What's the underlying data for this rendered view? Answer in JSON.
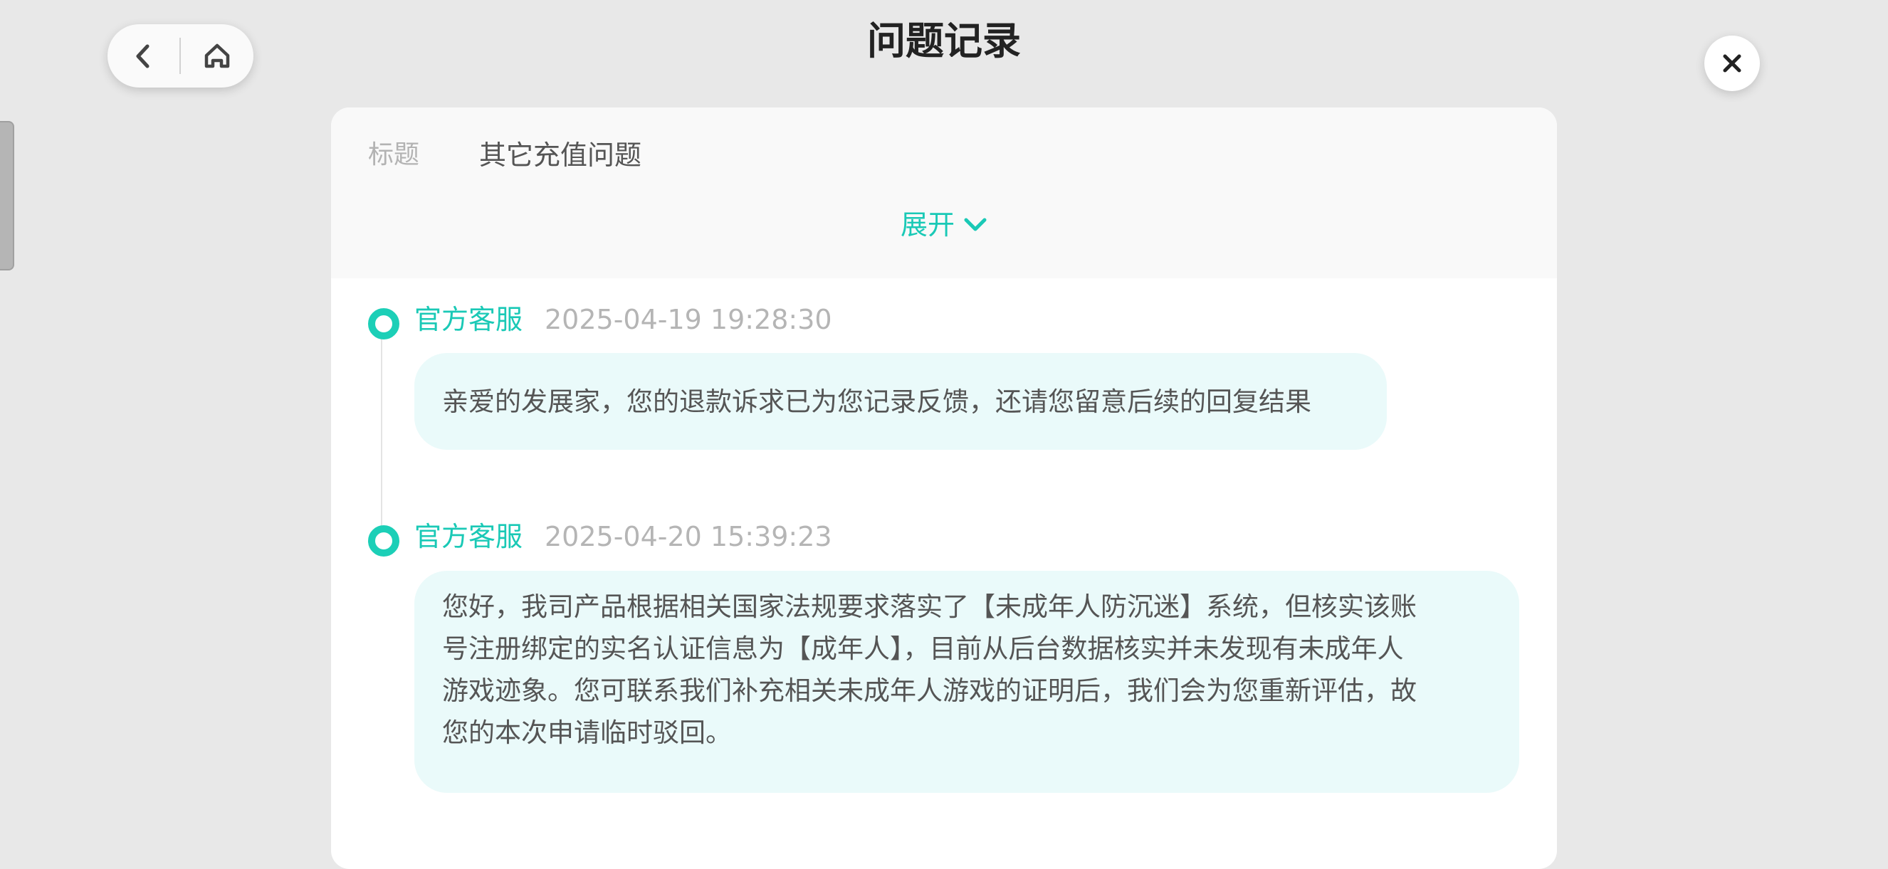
{
  "header": {
    "title": "问题记录",
    "back_icon": "chevron-left-icon",
    "home_icon": "home-icon",
    "close_icon": "close-icon"
  },
  "record": {
    "title_label": "标题",
    "title_value": "其它充值问题",
    "expand_label": "展开",
    "expand_icon": "chevron-down-icon"
  },
  "messages": [
    {
      "author": "官方客服",
      "timestamp": "2025-04-19 19:28:30",
      "lines": [
        "亲爱的发展家，您的退款诉求已为您记录反馈，还请您留意后续的回复结果"
      ]
    },
    {
      "author": "官方客服",
      "timestamp": "2025-04-20 15:39:23",
      "lines": [
        "您好，我司产品根据相关国家法规要求落实了【未成年人防沉迷】系统，但核实该账",
        "号注册绑定的实名认证信息为【成年人】，目前从后台数据核实并未发现有未成年人",
        "游戏迹象。您可联系我们补充相关未成年人游戏的证明后，我们会为您重新评估，故",
        "您的本次申请临时驳回。"
      ]
    }
  ],
  "colors": {
    "accent": "#1ac9b6",
    "bubble": "#eafafa",
    "background": "#e8e8e8"
  }
}
